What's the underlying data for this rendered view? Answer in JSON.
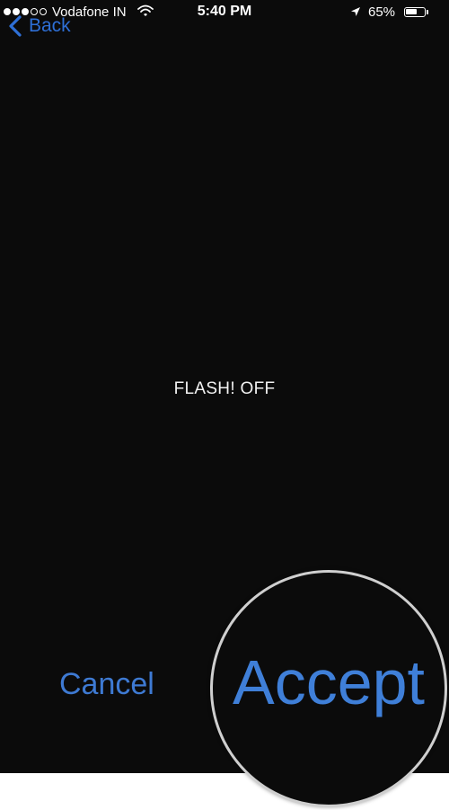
{
  "status_bar": {
    "carrier": "Vodafone IN",
    "time": "5:40 PM",
    "battery_percent": "65%",
    "battery_level": 0.65,
    "signal_bars_filled": 3,
    "signal_bars_total": 5
  },
  "nav": {
    "back_label": "Back"
  },
  "main": {
    "flash_status": "FLASH! OFF"
  },
  "actions": {
    "cancel_label": "Cancel",
    "accept_label": "Accept"
  },
  "colors": {
    "accent": "#2e6fd6",
    "background": "#0b0b0b",
    "text": "#f2f2f2"
  },
  "icons": {
    "back": "chevron-left-icon",
    "wifi": "wifi-icon",
    "location": "location-arrow-icon",
    "battery": "battery-icon"
  }
}
